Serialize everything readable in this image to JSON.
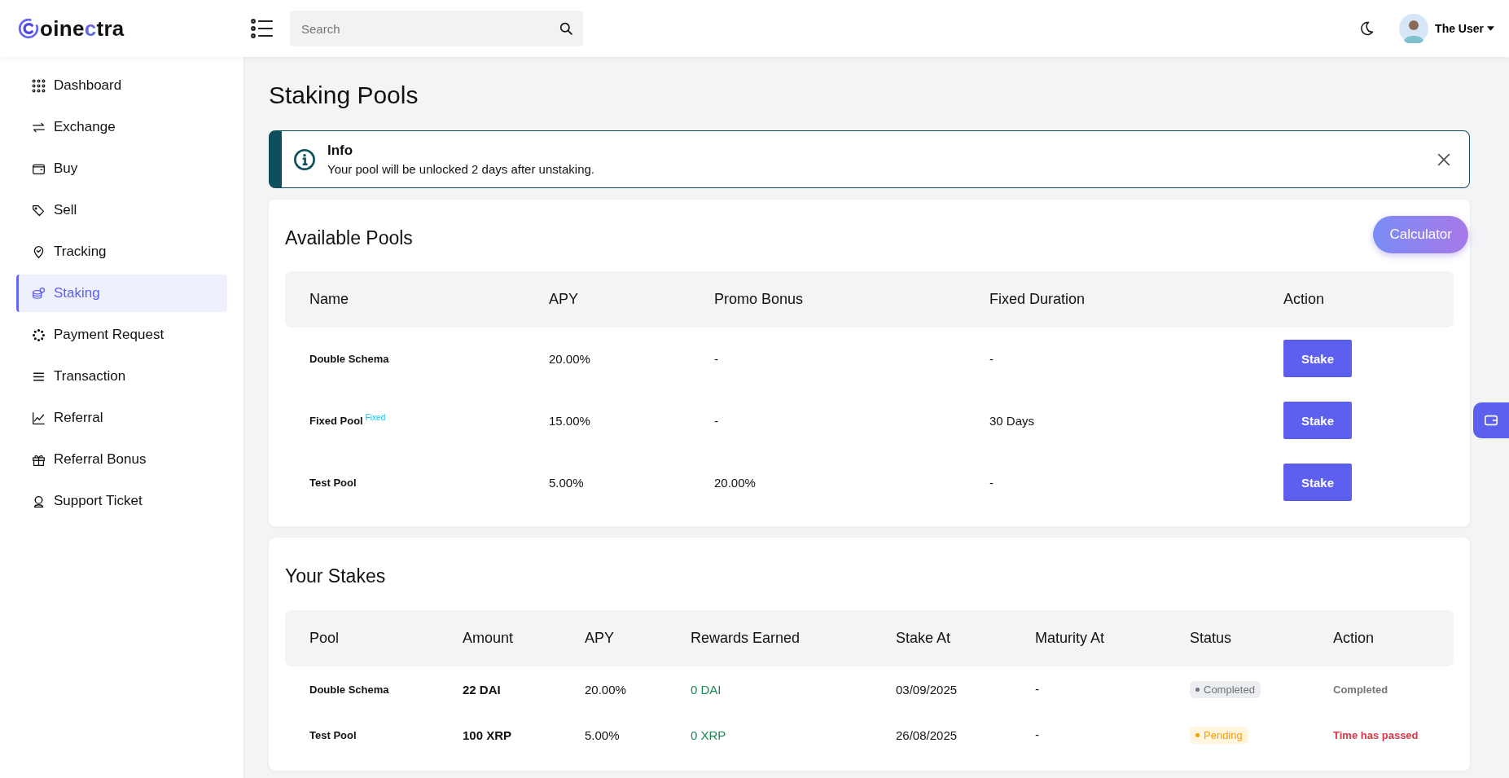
{
  "brand": {
    "before": "oine",
    "accent": "c",
    "after": "tra"
  },
  "search": {
    "placeholder": "Search"
  },
  "user": {
    "name": "The User"
  },
  "sidebar": {
    "items": [
      {
        "label": "Dashboard",
        "selected": false
      },
      {
        "label": "Exchange",
        "selected": false
      },
      {
        "label": "Buy",
        "selected": false
      },
      {
        "label": "Sell",
        "selected": false
      },
      {
        "label": "Tracking",
        "selected": false
      },
      {
        "label": "Staking",
        "selected": true
      },
      {
        "label": "Payment Request",
        "selected": false
      },
      {
        "label": "Transaction",
        "selected": false
      },
      {
        "label": "Referral",
        "selected": false
      },
      {
        "label": "Referral Bonus",
        "selected": false
      },
      {
        "label": "Support Ticket",
        "selected": false
      }
    ]
  },
  "page_title": "Staking Pools",
  "alert": {
    "title": "Info",
    "message": "Your pool will be unlocked 2 days after unstaking."
  },
  "available_pools": {
    "title": "Available Pools",
    "button": "Calculator",
    "columns": [
      "Name",
      "APY",
      "Promo Bonus",
      "Fixed Duration",
      "Action"
    ],
    "rows": [
      {
        "name": "Double Schema",
        "badge": "",
        "apy": "20.00%",
        "promo_bonus": "-",
        "fixed_duration": "-",
        "action": "Stake"
      },
      {
        "name": "Fixed Pool",
        "badge": "Fixed",
        "apy": "15.00%",
        "promo_bonus": "-",
        "fixed_duration": "30 Days",
        "action": "Stake"
      },
      {
        "name": "Test Pool",
        "badge": "",
        "apy": "5.00%",
        "promo_bonus": "20.00%",
        "fixed_duration": "-",
        "action": "Stake"
      }
    ]
  },
  "your_stakes": {
    "title": "Your Stakes",
    "columns": [
      "Pool",
      "Amount",
      "APY",
      "Rewards Earned",
      "Stake At",
      "Maturity At",
      "Status",
      "Action"
    ],
    "rows": [
      {
        "pool": "Double Schema",
        "amount": "22 DAI",
        "apy": "20.00%",
        "rewards": "0 DAI",
        "stake_at": "03/09/2025",
        "maturity_at": "-",
        "status": {
          "text": "Completed",
          "kind": "completed"
        },
        "action": {
          "text": "Completed",
          "kind": "completed"
        }
      },
      {
        "pool": "Test Pool",
        "amount": "100 XRP",
        "apy": "5.00%",
        "rewards": "0 XRP",
        "stake_at": "26/08/2025",
        "maturity_at": "-",
        "status": {
          "text": "Pending",
          "kind": "pending"
        },
        "action": {
          "text": "Time has passed",
          "kind": "expired"
        }
      }
    ]
  }
}
